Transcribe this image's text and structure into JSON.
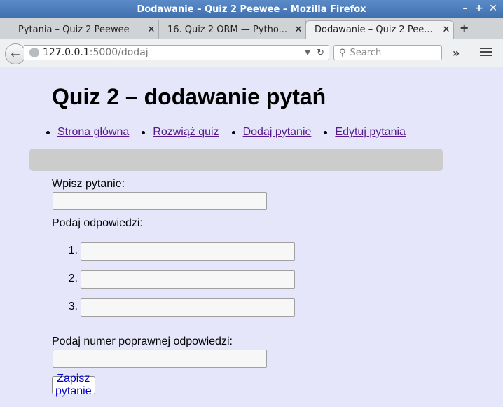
{
  "window": {
    "title": "Dodawanie – Quiz 2 Peewee – Mozilla Firefox",
    "controls": [
      "–",
      "+",
      "✕"
    ]
  },
  "tabs": [
    {
      "label": "Pytania – Quiz 2 Peewee",
      "close": "✕"
    },
    {
      "label": "16. Quiz 2 ORM — Pytho...",
      "close": "✕"
    },
    {
      "label": "Dodawanie – Quiz 2 Pee...",
      "close": "✕"
    }
  ],
  "new_tab": "+",
  "urlbar": {
    "host": "127.0.0.1",
    "path": ":5000/dodaj",
    "dropmarker": "▼",
    "reload": "↻"
  },
  "search": {
    "placeholder": "Search"
  },
  "toolbar": {
    "overflow": "»"
  },
  "page": {
    "title": "Quiz 2 – dodawanie pytań",
    "nav": [
      {
        "label": "Strona główna"
      },
      {
        "label": "Rozwiąż quiz"
      },
      {
        "label": "Dodaj pytanie"
      },
      {
        "label": "Edytuj pytania"
      }
    ],
    "form": {
      "question_label": "Wpisz pytanie:",
      "answers_label": "Podaj odpowiedzi:",
      "answers": [
        {
          "number": "1.",
          "value": ""
        },
        {
          "number": "2.",
          "value": ""
        },
        {
          "number": "3.",
          "value": ""
        }
      ],
      "correct_label": "Podaj numer poprawnej odpowiedzi:",
      "submit": "Zapisz pytanie"
    }
  }
}
